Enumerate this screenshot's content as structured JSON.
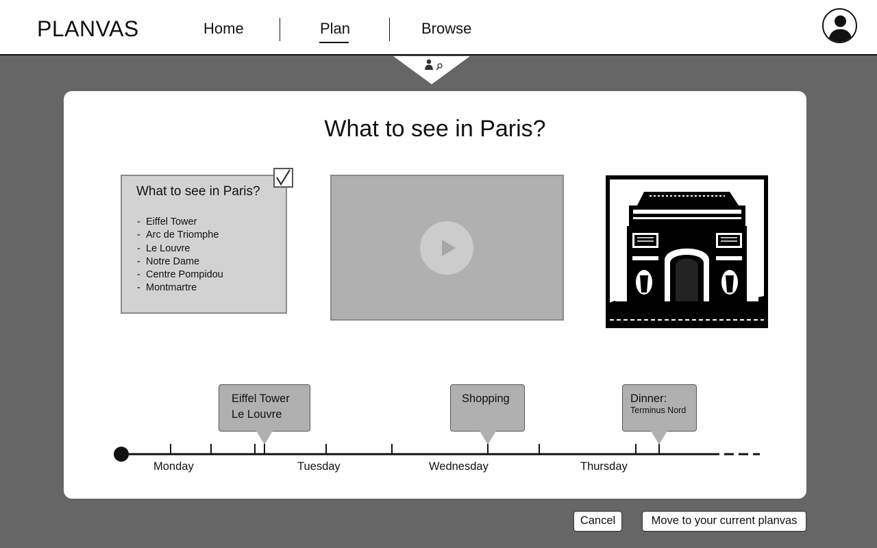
{
  "header": {
    "brand": "PLANVAS",
    "nav": [
      {
        "label": "Home",
        "active": false
      },
      {
        "label": "Plan",
        "active": true
      },
      {
        "label": "Browse",
        "active": false
      }
    ],
    "avatar_icon": "user-icon",
    "pull_tab_icon": "user-search-icon"
  },
  "card": {
    "title": "What to see in Paris?",
    "note": {
      "title": "What to see in Paris?",
      "checked": true,
      "items": [
        "Eiffel Tower",
        "Arc de Triomphe",
        "Le Louvre",
        "Notre Dame",
        "Centre Pompidou",
        "Montmartre"
      ]
    },
    "video": {
      "icon": "play-icon"
    },
    "photo": {
      "icon": "arc-de-triomphe-image"
    }
  },
  "timeline": {
    "days": [
      "Monday",
      "Tuesday",
      "Wednesday",
      "Thursday"
    ],
    "events": [
      {
        "line1": "Eiffel Tower",
        "line2": "Le Louvre"
      },
      {
        "line1": "Shopping"
      },
      {
        "line1": "Dinner:",
        "line2": "Terminus Nord"
      }
    ]
  },
  "footer": {
    "cancel_label": "Cancel",
    "move_label": "Move to your current planvas"
  },
  "colors": {
    "background": "#666666",
    "card": "#ffffff",
    "note": "#d2d2d2",
    "video": "#b0b0b0",
    "bubble": "#b0b0b0"
  }
}
